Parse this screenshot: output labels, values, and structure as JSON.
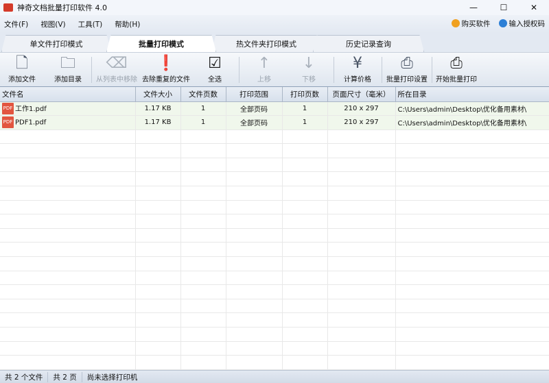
{
  "window": {
    "title": "神奇文档批量打印软件 4.0",
    "minimize": "—",
    "maximize": "☐",
    "close": "✕"
  },
  "menu": {
    "items": [
      "文件(F)",
      "视图(V)",
      "工具(T)",
      "帮助(H)"
    ],
    "buy": "购买软件",
    "license": "输入授权码"
  },
  "tabs": [
    "单文件打印模式",
    "批量打印模式",
    "热文件夹打印模式",
    "历史记录查询"
  ],
  "active_tab": "批量打印模式",
  "toolbar": [
    {
      "label": "添加文件",
      "icon": "add-file-icon",
      "glyph": "🗋",
      "enabled": true
    },
    {
      "label": "添加目录",
      "icon": "add-folder-icon",
      "glyph": "🗀",
      "enabled": true
    },
    {
      "label": "从列表中移除",
      "icon": "remove-icon",
      "glyph": "⌫",
      "enabled": false
    },
    {
      "label": "去除重复的文件",
      "icon": "exclamation-icon",
      "glyph": "❗",
      "enabled": true
    },
    {
      "label": "全选",
      "icon": "checklist-icon",
      "glyph": "☑",
      "enabled": true
    },
    {
      "label": "上移",
      "icon": "arrow-up-icon",
      "glyph": "↑",
      "enabled": false
    },
    {
      "label": "下移",
      "icon": "arrow-down-icon",
      "glyph": "↓",
      "enabled": false
    },
    {
      "label": "计算价格",
      "icon": "yen-icon",
      "glyph": "¥",
      "enabled": true
    },
    {
      "label": "批量打印设置",
      "icon": "printer-settings-icon",
      "glyph": "⎙",
      "enabled": true
    },
    {
      "label": "开始批量打印",
      "icon": "printer-icon",
      "glyph": "⎙",
      "enabled": true
    }
  ],
  "table": {
    "columns": [
      "文件名",
      "文件大小",
      "文件页数",
      "打印范围",
      "打印页数",
      "页面尺寸（毫米）",
      "所在目录"
    ],
    "rows": [
      [
        "工作1.pdf",
        "1.17 KB",
        "1",
        "全部页码",
        "1",
        "210 x 297",
        "C:\\Users\\admin\\Desktop\\优化备用素材\\"
      ],
      [
        "PDF1.pdf",
        "1.17 KB",
        "1",
        "全部页码",
        "1",
        "210 x 297",
        "C:\\Users\\admin\\Desktop\\优化备用素材\\"
      ]
    ],
    "file_icon_text": "PDF"
  },
  "status": [
    "共 2 个文件",
    "共 2 页",
    "尚未选择打印机"
  ]
}
